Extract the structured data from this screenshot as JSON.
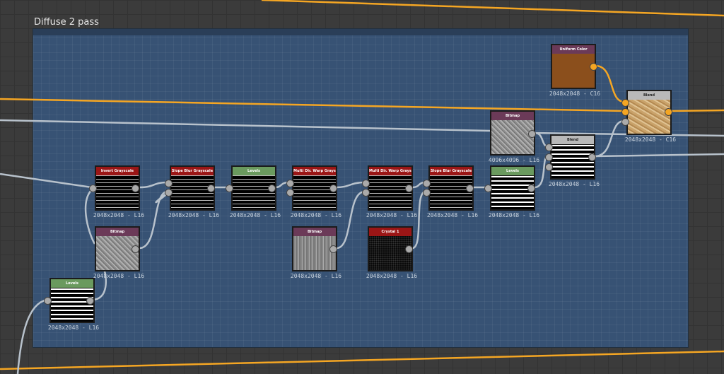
{
  "frame": {
    "title": "Diffuse 2 pass"
  },
  "colors": {
    "generator": "#6b3a58",
    "filter": "#9b1616",
    "adjust": "#6a9a5e",
    "blend": "#b9b9b9",
    "color_wire": "#f5a623",
    "gray_wire": "#b8c2cc",
    "frame_bg": "#375274"
  },
  "nodes": [
    {
      "label": "Uniform Color",
      "caption": "2048x2048 - C16",
      "kind": "generator",
      "thumb": "brown"
    },
    {
      "label": "Blend",
      "caption": "2048x2048 - C16",
      "kind": "blend",
      "thumb": "tan"
    },
    {
      "label": "Bitmap",
      "caption": "4096x4096 - L16",
      "kind": "generator",
      "thumb": "gray"
    },
    {
      "label": "Blend",
      "caption": "2048x2048 - L16",
      "kind": "blend",
      "thumb": "noise2"
    },
    {
      "label": "Invert Grayscale",
      "caption": "2048x2048 - L16",
      "kind": "filter",
      "thumb": "noise"
    },
    {
      "label": "Slope Blur Grayscale",
      "caption": "2048x2048 - L16",
      "kind": "filter",
      "thumb": "noise"
    },
    {
      "label": "Levels",
      "caption": "2048x2048 - L16",
      "kind": "adjust",
      "thumb": "noise"
    },
    {
      "label": "Multi Dir. Warp Grayscale",
      "caption": "2048x2048 - L16",
      "kind": "filter",
      "thumb": "noise"
    },
    {
      "label": "Multi Dir. Warp Grayscale",
      "caption": "2048x2048 - L16",
      "kind": "filter",
      "thumb": "noise"
    },
    {
      "label": "Slope Blur Grayscale",
      "caption": "2048x2048 - L16",
      "kind": "filter",
      "thumb": "noise"
    },
    {
      "label": "Levels",
      "caption": "2048x2048 - L16",
      "kind": "adjust",
      "thumb": "noise2"
    },
    {
      "label": "Bitmap",
      "caption": "2048x2048 - L16",
      "kind": "generator",
      "thumb": "gray"
    },
    {
      "label": "Bitmap",
      "caption": "2048x2048 - L16",
      "kind": "generator",
      "thumb": "vgray"
    },
    {
      "label": "Crystal 1",
      "caption": "2048x2048 - L16",
      "kind": "filter",
      "thumb": "crystal"
    },
    {
      "label": "Levels",
      "caption": "2048x2048 - L16",
      "kind": "adjust",
      "thumb": "noise2"
    }
  ]
}
